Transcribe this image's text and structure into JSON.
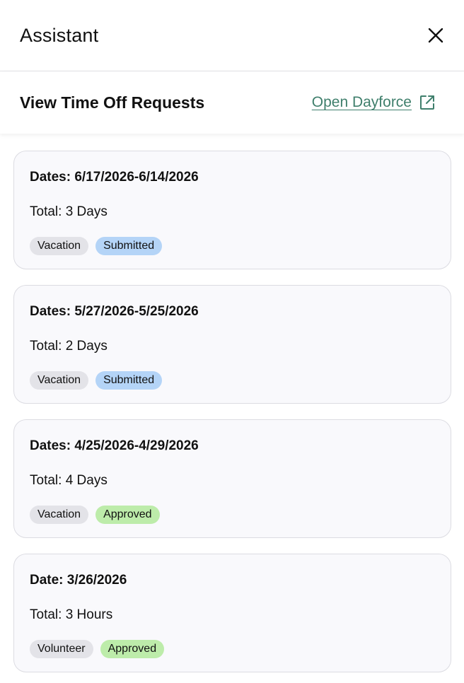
{
  "header": {
    "title": "Assistant",
    "close_icon": "close-icon"
  },
  "section": {
    "title": "View Time Off Requests",
    "open_link_label": "Open Dayforce",
    "open_link_icon": "external-link-icon"
  },
  "colors": {
    "link": "#3f7f6c",
    "submitted_badge": "#b4d4f7",
    "approved_badge": "#bdecaa",
    "type_badge": "#e3e3e8",
    "card_background": "#f9f9fc"
  },
  "requests": [
    {
      "dates": "Dates: 6/17/2026-6/14/2026",
      "total": "Total: 3 Days",
      "type": "Vacation",
      "status": "Submitted"
    },
    {
      "dates": "Dates: 5/27/2026-5/25/2026",
      "total": "Total: 2 Days",
      "type": "Vacation",
      "status": "Submitted"
    },
    {
      "dates": "Dates: 4/25/2026-4/29/2026",
      "total": "Total: 4 Days",
      "type": "Vacation",
      "status": "Approved"
    },
    {
      "dates": "Date: 3/26/2026",
      "total": "Total: 3 Hours",
      "type": "Volunteer",
      "status": "Approved"
    }
  ]
}
